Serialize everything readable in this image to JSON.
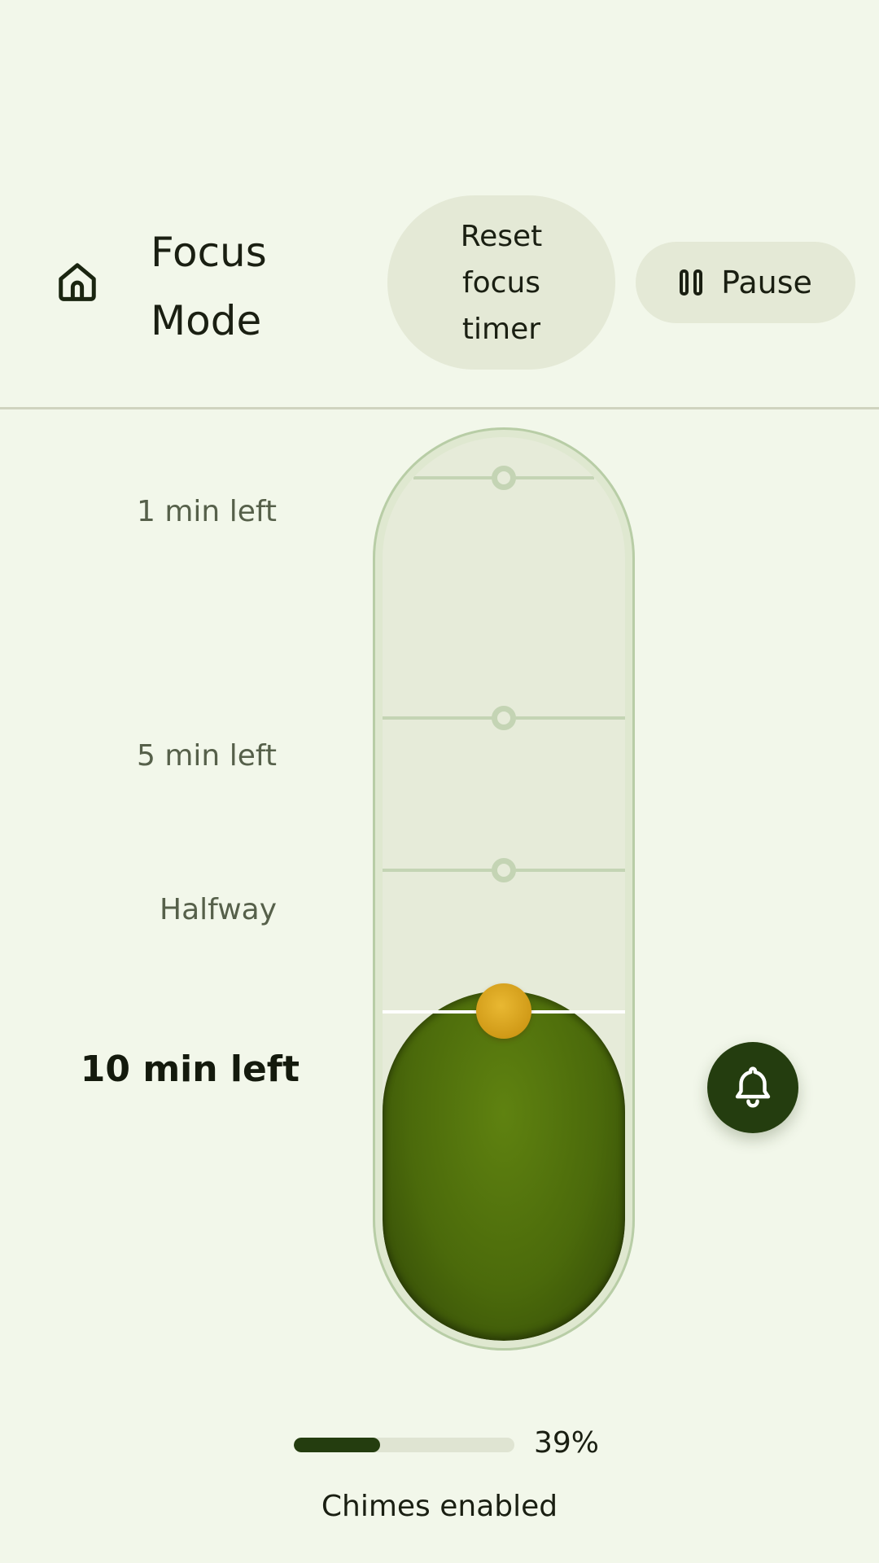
{
  "header": {
    "title": "Focus Mode",
    "home_icon": "home-icon",
    "reset_label": "Reset focus timer",
    "pause_label": "Pause",
    "pause_icon": "pause-icon"
  },
  "timer": {
    "milestones": [
      {
        "label": "1 min left",
        "current": false
      },
      {
        "label": "5 min left",
        "current": false
      },
      {
        "label": "Halfway",
        "current": false
      },
      {
        "label": "10 min left",
        "current": true
      }
    ],
    "accent_color": "#243d0f",
    "fill_color": "#4b6a0b",
    "handle_color": "#d09a17"
  },
  "bell": {
    "icon": "bell-icon"
  },
  "progress": {
    "value": 0.39,
    "label": "39%"
  },
  "status": {
    "chimes": "Chimes enabled"
  }
}
